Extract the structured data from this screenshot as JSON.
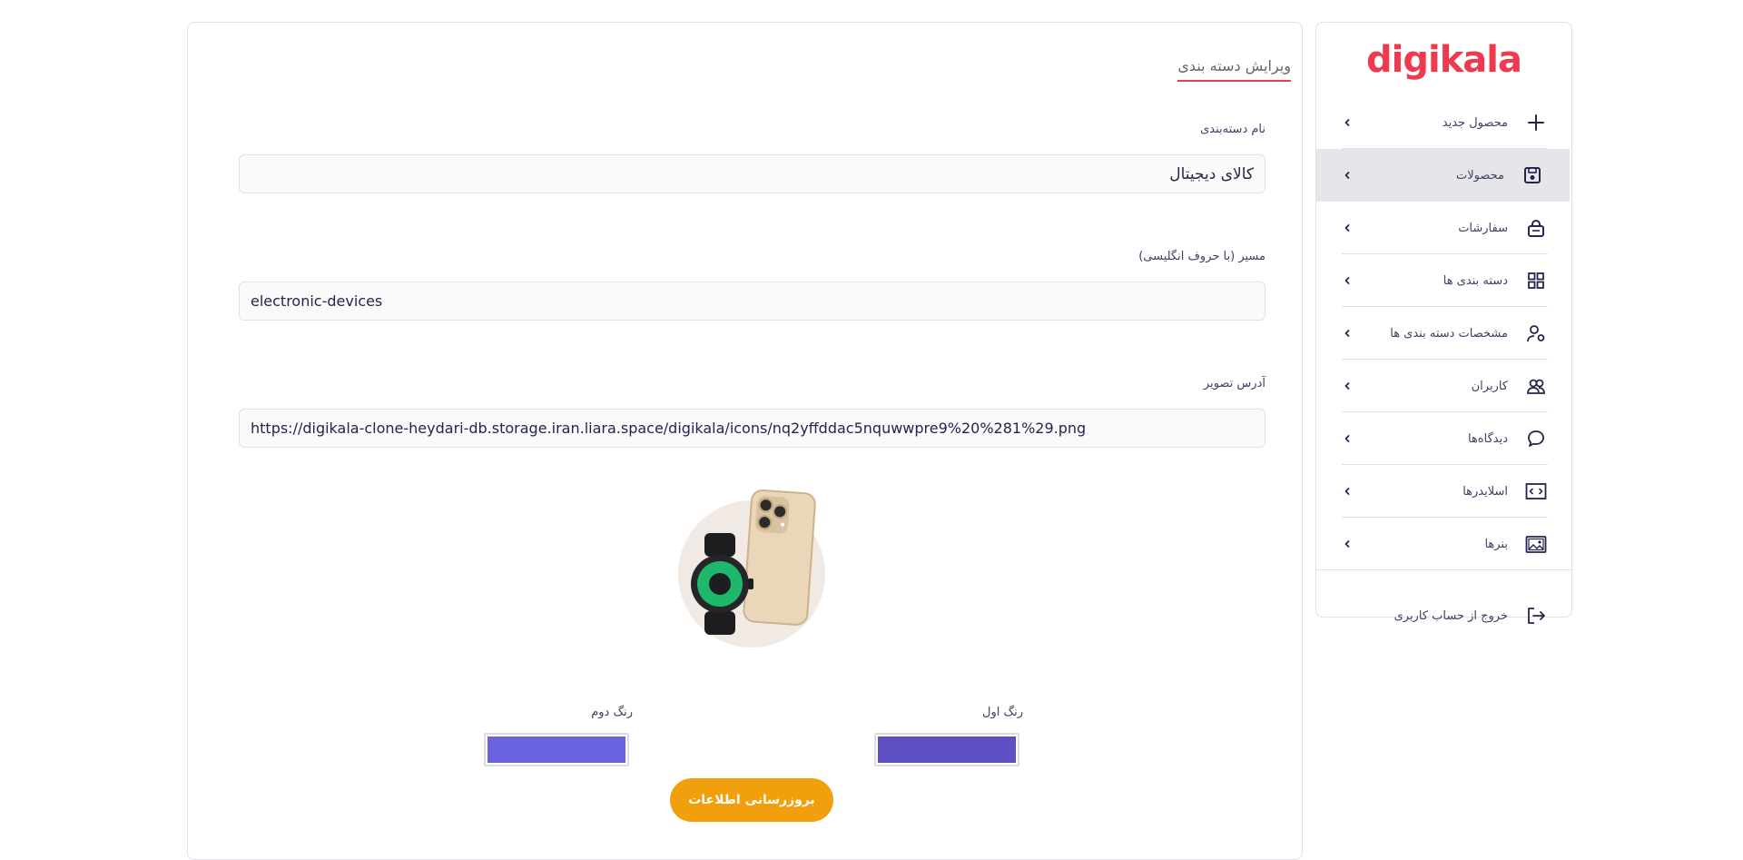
{
  "form": {
    "heading": "ویرایش دسته بندی",
    "name_label": "نام دسته‌بندی",
    "name_value": "کالای دیجیتال",
    "slug_label": "مسیر (با حروف انگلیسی)",
    "slug_value": "electronic-devices",
    "image_label": "آدرس تصویر",
    "image_value": "https://digikala-clone-heydari-db.storage.iran.liara.space/digikala/icons/nq2yffddac5nquwwpre9%20%281%29.png",
    "color1_label": "رنگ اول",
    "color1_value": "#5b4fc2",
    "color2_label": "رنگ دوم",
    "color2_value": "#6a62de",
    "submit_label": "بروزرسانی اطلاعات"
  },
  "sidebar": {
    "logo": "digikala",
    "items": [
      {
        "label": "محصول جدید",
        "icon": "plus-icon"
      },
      {
        "label": "محصولات",
        "icon": "save-icon"
      },
      {
        "label": "سفارشات",
        "icon": "bag-icon"
      },
      {
        "label": "دسته بندی ها",
        "icon": "grid-icon"
      },
      {
        "label": "مشخصات دسته بندی ها",
        "icon": "user-pin-icon"
      },
      {
        "label": "کاربران",
        "icon": "users-icon"
      },
      {
        "label": "دیدگاه‌ها",
        "icon": "chat-icon"
      },
      {
        "label": "اسلایدرها",
        "icon": "slider-icon"
      },
      {
        "label": "بنرها",
        "icon": "image-icon"
      }
    ],
    "logout_label": "خروج از حساب کاربری"
  },
  "colors": {
    "accent": "#ef394e",
    "button": "#f29f0d",
    "active_bg": "#e5e6ea"
  }
}
